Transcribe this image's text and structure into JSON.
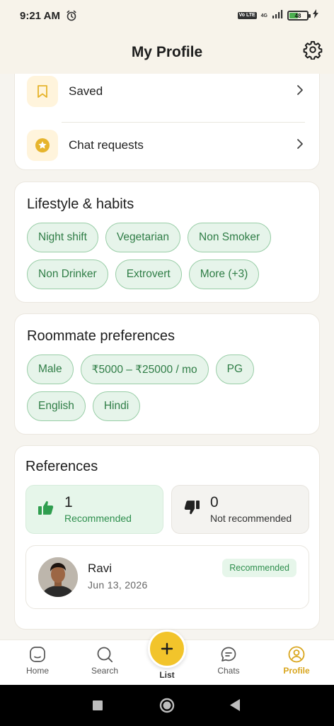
{
  "status_bar": {
    "time": "9:21 AM",
    "volte": "Vo LTE",
    "network": "4G",
    "battery": "48"
  },
  "header": {
    "title": "My Profile"
  },
  "menu": {
    "items": [
      {
        "label": "Saved"
      },
      {
        "label": "Chat requests"
      }
    ]
  },
  "lifestyle": {
    "title": "Lifestyle & habits",
    "chips": [
      "Night shift",
      "Vegetarian",
      "Non Smoker",
      "Non Drinker",
      "Extrovert",
      "More (+3)"
    ]
  },
  "preferences": {
    "title": "Roommate preferences",
    "chips": [
      "Male",
      "₹5000 – ₹25000 / mo",
      "PG",
      "English",
      "Hindi"
    ]
  },
  "references": {
    "title": "References",
    "recommended": {
      "count": "1",
      "label": "Recommended"
    },
    "not_recommended": {
      "count": "0",
      "label": "Not recommended"
    },
    "review": {
      "name": "Ravi",
      "date": "Jun 13, 2026",
      "badge": "Recommended"
    }
  },
  "nav": {
    "home": "Home",
    "search": "Search",
    "list": "List",
    "chats": "Chats",
    "profile": "Profile"
  },
  "colors": {
    "accent": "#f2c42b",
    "chip_bg": "#e6f4ea",
    "chip_text": "#2f7d46",
    "active_nav": "#d9a61e"
  },
  "icons": {
    "saved": "bookmark-icon",
    "chat_requests": "star-badge-icon",
    "settings": "gear-icon"
  }
}
